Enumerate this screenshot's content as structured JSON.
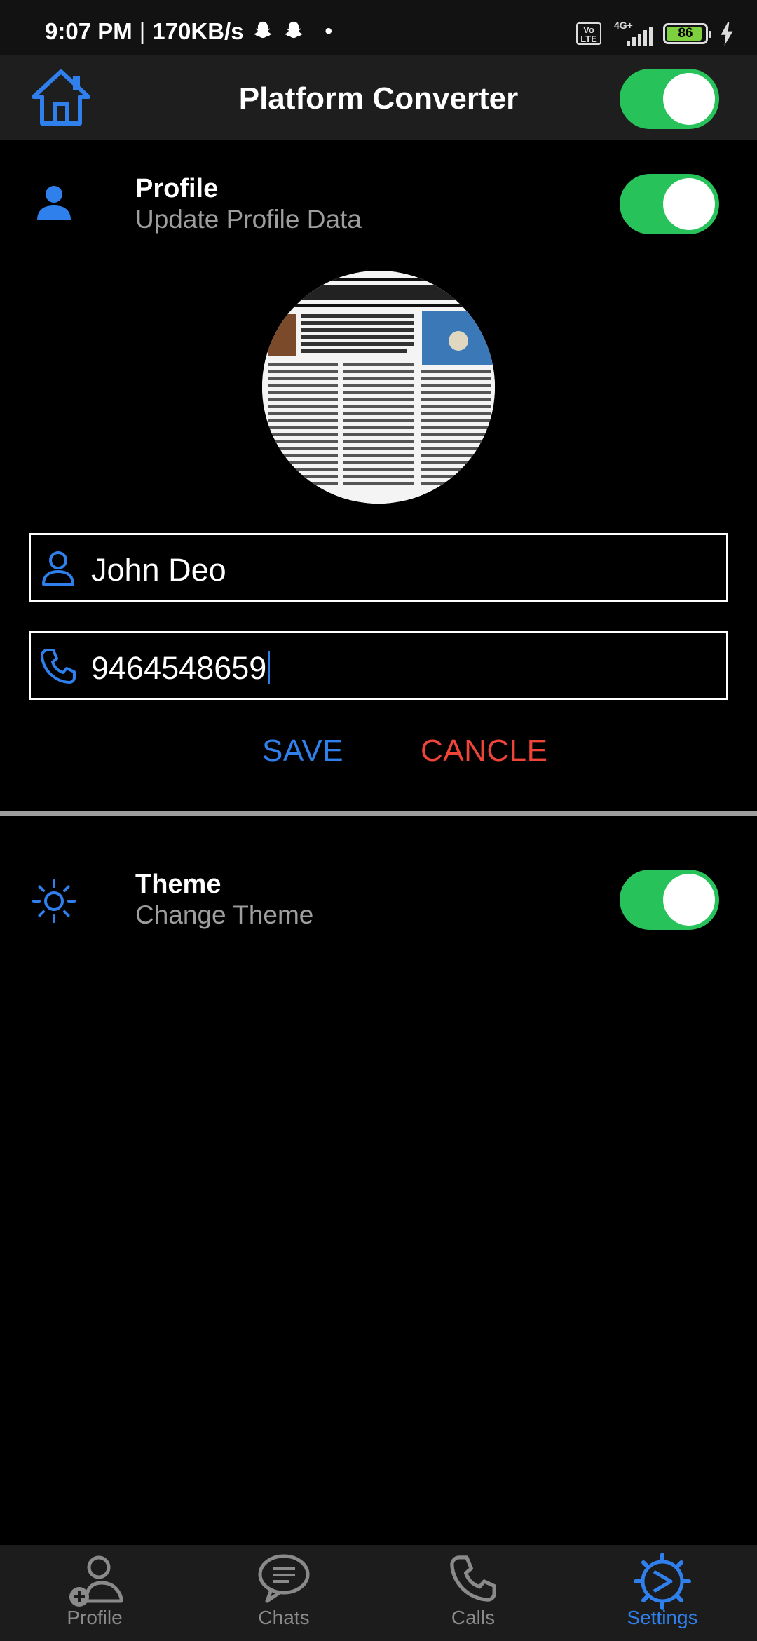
{
  "status_bar": {
    "time": "9:07 PM",
    "separator": "|",
    "speed": "170KB/s",
    "network_badge": "Vo LTE",
    "network_type": "4G+",
    "battery_level": "86"
  },
  "app_bar": {
    "title": "Platform Converter",
    "home_icon": "home-icon",
    "toggle_on": true
  },
  "profile_section": {
    "title": "Profile",
    "subtitle": "Update Profile Data",
    "icon": "person-icon",
    "toggle_on": true,
    "name_value": "John Deo",
    "phone_value": "9464548659",
    "save_label": "SAVE",
    "cancel_label": "CANCLE"
  },
  "theme_section": {
    "title": "Theme",
    "subtitle": "Change Theme",
    "icon": "sun-icon",
    "toggle_on": true
  },
  "bottom_nav": {
    "items": [
      {
        "label": "Profile",
        "icon": "add-person-icon",
        "active": false
      },
      {
        "label": "Chats",
        "icon": "chat-bubble-icon",
        "active": false
      },
      {
        "label": "Calls",
        "icon": "phone-icon",
        "active": false
      },
      {
        "label": "Settings",
        "icon": "settings-gear-icon",
        "active": true
      }
    ]
  },
  "colors": {
    "accent": "#2f80ed",
    "toggle_on": "#27c35a",
    "cancel": "#ef4438",
    "background": "#000000",
    "bar_background": "#1e1e1e"
  }
}
